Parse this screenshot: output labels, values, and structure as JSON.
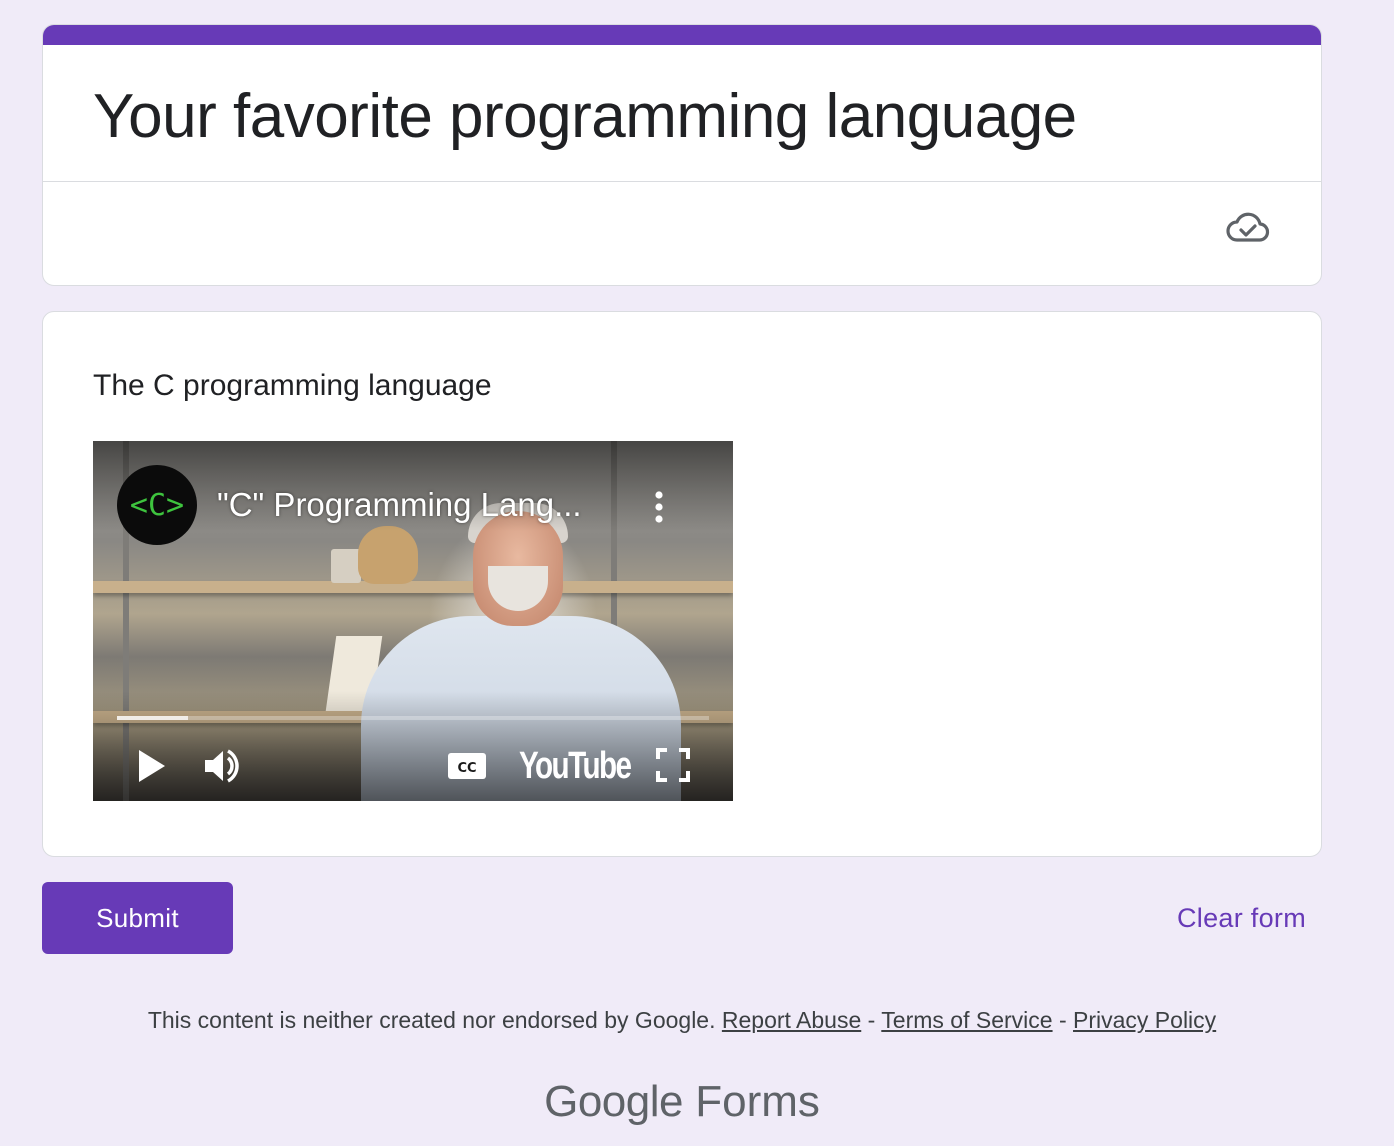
{
  "form": {
    "title": "Your favorite programming language",
    "accent_color": "#673ab7",
    "saved_icon": "cloud-check-icon"
  },
  "item": {
    "title": "The C programming language",
    "video": {
      "channel_logo_text": "<C>",
      "title": "\"C\" Programming Lang...",
      "platform_label": "YouTube",
      "progress": 0.12,
      "controls": [
        "play-icon",
        "volume-icon",
        "captions-icon",
        "fullscreen-icon",
        "more-options-icon"
      ]
    }
  },
  "actions": {
    "submit_label": "Submit",
    "clear_label": "Clear form"
  },
  "footer": {
    "disclaimer": "This content is neither created nor endorsed by Google.",
    "report_abuse": "Report Abuse",
    "separator": "-",
    "terms": "Terms of Service",
    "privacy": "Privacy Policy"
  },
  "brand": {
    "google": "Google",
    "forms": "Forms"
  }
}
